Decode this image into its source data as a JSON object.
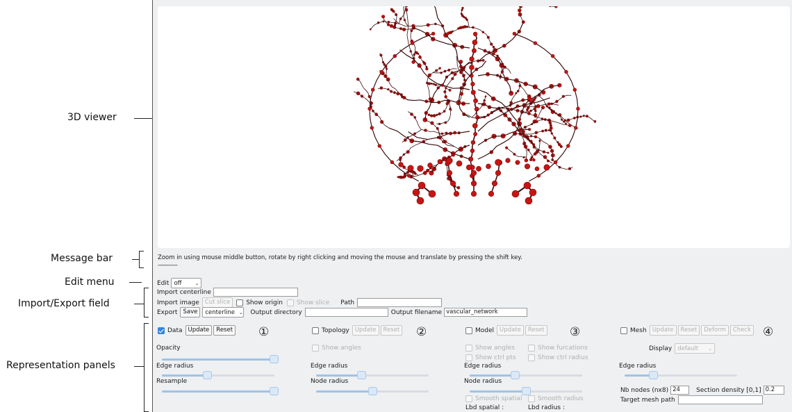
{
  "annotations": {
    "viewer": "3D viewer",
    "message_bar": "Message bar",
    "edit_menu": "Edit menu",
    "import_export": "Import/Export field",
    "representation": "Representation panels"
  },
  "message": {
    "line1": "Zoom in using mouse middle button, rotate by right clicking and moving the mouse and translate by pressing the shift key.",
    "line2": "-----------"
  },
  "edit": {
    "label": "Edit",
    "value": "off"
  },
  "import_centerline": {
    "label": "Import centerline",
    "value": ""
  },
  "import_image": {
    "label": "Import image",
    "cut_slice": "Cut slice",
    "show_origin": "Show origin",
    "show_slice": "Show slice",
    "path_label": "Path",
    "path_value": ""
  },
  "export": {
    "label": "Export",
    "save": "Save",
    "format": "centerline",
    "output_directory_label": "Output directory",
    "output_directory_value": "",
    "output_filename_label": "Output filename",
    "output_filename_value": "vascular_network"
  },
  "panels": {
    "data": {
      "number": "①",
      "label": "Data",
      "checked": true,
      "update": "Update",
      "reset": "Reset",
      "opacity_label": "Opacity",
      "opacity": 0.98,
      "edge_radius_label": "Edge radius",
      "edge_radius": 0.4,
      "resample_label": "Resample",
      "resample": 1.0
    },
    "topology": {
      "number": "②",
      "label": "Topology",
      "checked": false,
      "update": "Update",
      "reset": "Reset",
      "show_angles": "Show angles",
      "edge_radius_label": "Edge radius",
      "edge_radius": 0.4,
      "node_radius_label": "Node radius",
      "node_radius": 0.5
    },
    "model": {
      "number": "③",
      "label": "Model",
      "checked": false,
      "update": "Update",
      "reset": "Reset",
      "show_angles": "Show angles",
      "show_furcations": "Show furcations",
      "show_ctrl_pts": "Show ctrl pts",
      "show_ctrl_radius": "Show ctrl radius",
      "edge_radius_label": "Edge radius",
      "edge_radius": 0.4,
      "node_radius_label": "Node radius",
      "node_radius": 0.5,
      "smooth_spatial": "Smooth spatial",
      "smooth_radius": "Smooth radius",
      "lbd_spatial": "Lbd spatial :",
      "lbd_radius": "Lbd radius :"
    },
    "mesh": {
      "number": "④",
      "label": "Mesh",
      "checked": false,
      "update": "Update",
      "reset": "Reset",
      "deform": "Deform",
      "check": "Check",
      "display_label": "Display",
      "display_value": "default",
      "edge_radius_label": "Edge radius",
      "edge_radius": 0.25,
      "nb_nodes_label": "Nb nodes (nx8)",
      "nb_nodes_value": "24",
      "section_density_label": "Section density [0,1]",
      "section_density_value": "0.2",
      "target_mesh_label": "Target mesh path",
      "target_mesh_value": ""
    }
  },
  "colors": {
    "vessel_dark": "#3a0d0d",
    "vessel_red": "#c81414",
    "panel_bg": "#eef0f2",
    "accent": "#3584e4"
  }
}
